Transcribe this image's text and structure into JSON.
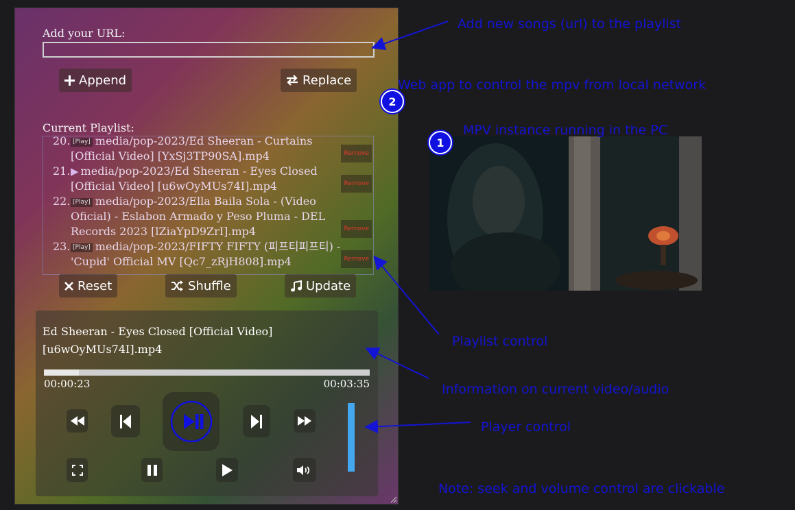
{
  "form": {
    "url_label": "Add your URL:",
    "url_value": "",
    "append_label": "Append",
    "replace_label": "Replace"
  },
  "playlist": {
    "label": "Current Playlist:",
    "play_tag": "[Play]",
    "remove_label": "Remove",
    "items": [
      {
        "num": "20.",
        "text": "media/pop-2023/Ed Sheeran - Curtains [Official Video] [YxSj3TP90SA].mp4",
        "current": false
      },
      {
        "num": "21.",
        "text": "media/pop-2023/Ed Sheeran - Eyes Closed [Official Video] [u6wOyMUs74I].mp4",
        "current": true
      },
      {
        "num": "22.",
        "text": "media/pop-2023/Ella Baila Sola - (Video Oficial) - Eslabon Armado y Peso Pluma - DEL Records 2023 [lZiaYpD9ZrI].mp4",
        "current": false
      },
      {
        "num": "23.",
        "text": "media/pop-2023/FIFTY FIFTY (피프티피프티) - 'Cupid' Official MV [Qc7_zRjH808].mp4",
        "current": false
      }
    ],
    "reset_label": "Reset",
    "shuffle_label": "Shuffle",
    "update_label": "Update"
  },
  "player": {
    "title": "Ed Sheeran - Eyes Closed [Official Video] [u6wOyMUs74I].mp4",
    "elapsed": "00:00:23",
    "duration": "00:03:35",
    "progress_fraction": 0.107,
    "volume_fraction": 1.0
  },
  "annotations": {
    "add_songs": "Add new songs (url) to the playlist",
    "web_app": "Web app to control the mpv from local network",
    "mpv_instance": "MPV instance running in the PC",
    "playlist_control": "Playlist control",
    "info": "Information on current video/audio",
    "player_control": "Player control",
    "note": "Note: seek and volume control are clickable",
    "marker_1": "1",
    "marker_2": "2"
  },
  "colors": {
    "annotation": "#1414d4",
    "volume": "#44a8ee",
    "remove": "#e53a2e"
  }
}
